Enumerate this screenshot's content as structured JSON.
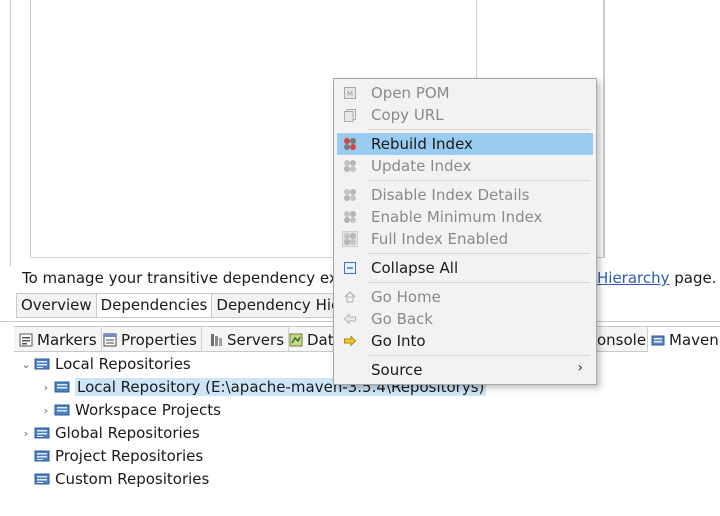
{
  "editor": {
    "info_text": "To manage your transitive dependency exc",
    "info_link": "Hierarchy",
    "info_suffix": " page.",
    "tabs": [
      "Overview",
      "Dependencies",
      "Dependency Hier"
    ]
  },
  "views": {
    "tabs": [
      {
        "label": "Markers",
        "icon": "markers-icon"
      },
      {
        "label": "Properties",
        "icon": "properties-icon"
      },
      {
        "label": "Servers",
        "icon": "servers-icon"
      },
      {
        "label": "Dat",
        "icon": "data-source-icon"
      },
      {
        "label": "onsole",
        "icon": "console-icon"
      },
      {
        "label": "Maven",
        "icon": "maven-repositories-icon"
      }
    ]
  },
  "tree": {
    "items": [
      {
        "label": "Local Repositories",
        "expanded": true
      },
      {
        "label": "Local Repository (E:\\apache-maven-3.5.4\\Repositorys)",
        "selected": true
      },
      {
        "label": "Workspace Projects"
      },
      {
        "label": "Global Repositories"
      },
      {
        "label": "Project Repositories"
      },
      {
        "label": "Custom Repositories"
      }
    ]
  },
  "menu": {
    "items": [
      {
        "label": "Open POM",
        "enabled": false,
        "icon": "pom-icon"
      },
      {
        "label": "Copy URL",
        "enabled": false,
        "icon": "copy-icon"
      },
      {
        "label": "Rebuild Index",
        "enabled": true,
        "highlighted": true,
        "icon": "index-icon"
      },
      {
        "label": "Update Index",
        "enabled": false,
        "icon": "index-icon"
      },
      {
        "label": "Disable Index Details",
        "enabled": false,
        "icon": "index-icon"
      },
      {
        "label": "Enable Minimum Index",
        "enabled": false,
        "icon": "index-icon"
      },
      {
        "label": "Full Index Enabled",
        "enabled": false,
        "icon": "index-icon"
      },
      {
        "label": "Collapse All",
        "enabled": true,
        "icon": "collapse-all-icon"
      },
      {
        "label": "Go Home",
        "enabled": false,
        "icon": "home-icon"
      },
      {
        "label": "Go Back",
        "enabled": false,
        "icon": "back-arrow-icon"
      },
      {
        "label": "Go Into",
        "enabled": true,
        "icon": "go-into-arrow-icon"
      },
      {
        "label": "Source",
        "enabled": true,
        "submenu": true,
        "submenu_glyph": "›"
      }
    ]
  },
  "colors": {
    "menu_highlight": "#99ccf0",
    "tree_selection": "#cde6f7",
    "link": "#2a59b8",
    "disabled_text": "#8a8a8a"
  }
}
